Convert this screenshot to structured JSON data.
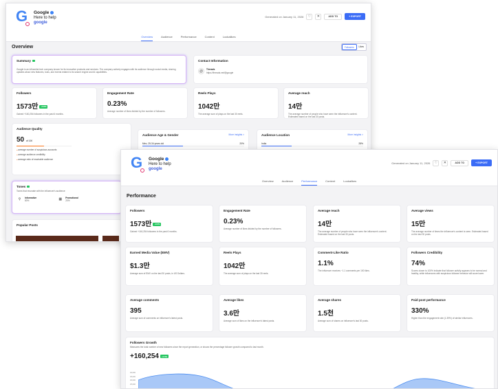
{
  "brand": {
    "name": "Google",
    "tagline": "Here to help",
    "handle": "google"
  },
  "header": {
    "generated": "Generated on January 11, 2026",
    "add_to": "ADD TO",
    "export": "+ EXPORT"
  },
  "tabs": [
    "Overview",
    "Audience",
    "Performance",
    "Content",
    "Lookalikes"
  ],
  "s1": {
    "section": "Overview",
    "toggle": [
      "Followers",
      "Likes"
    ],
    "summary_title": "Summary",
    "summary_text": "Google is an influential tech company known for its innovative products and services. The company actively engages with its audience through social media, sharing updates about new features, tools, and events related to its search engine and AI capabilities.",
    "contact_title": "Contact Information",
    "contact_site": "Threads",
    "contact_url": "https://threads.net/@google",
    "followers_t": "Followers",
    "followers_v": "1573만",
    "followers_badge": "+0.6%",
    "followers_d": "Gained +160,254 followers in the past 6 months.",
    "eng_t": "Engagement Rate",
    "eng_v": "0.23%",
    "eng_d": "Average number of likes divided by the number of followers.",
    "reels_t": "Reels Plays",
    "reels_v": "1042만",
    "reels_d": "The average sum of plays on the last 30 reels.",
    "reach_t": "Average reach",
    "reach_v": "14만",
    "reach_d": "The average number of people who have seen the influencer's content. Estimated based on the last 30 posts.",
    "aq_t": "Audience Quality",
    "aq_v": "50",
    "aq_unit": "of 100",
    "aq_b1": "average number of suspicious accounts",
    "aq_b2": "average audience credibility",
    "aq_b3": "average ratio of reachable audience",
    "age_t": "Audience Age & Gender",
    "age_more": "More insights >",
    "age_r1": "Men, 25-34 years old",
    "age_r1v": "20%",
    "age_r2": "Men, 18-24 years old",
    "age_r2v": "22%",
    "loc_t": "Audience Location",
    "loc_more": "More insights >",
    "loc_r1": "India",
    "loc_r1v": "28%",
    "loc_r2": "United States",
    "loc_r2v": "15%",
    "tones_t": "Tones",
    "tones_d": "Tones that resonate with the influencer's audience",
    "tone1": "Informative",
    "tone1v": "80%",
    "tone2": "Promotional",
    "tone2v": "20%",
    "popular": "Popular Posts"
  },
  "s2": {
    "section": "Performance",
    "c1t": "Followers",
    "c1v": "1573만",
    "c1b": "+0.6%",
    "c1d": "Gained +160,254 followers in the past 6 months.",
    "c2t": "Engagement Rate",
    "c2v": "0.23%",
    "c2d": "Average number of likes divided by the number of followers.",
    "c3t": "Average reach",
    "c3v": "14만",
    "c3d": "The average number of people who have seen the influencer's content. Estimated based on the last 30 posts.",
    "c4t": "Average views",
    "c4v": "15만",
    "c4d": "The average number of times the influencer's content is seen. Estimated based on the last 30 posts.",
    "c5t": "Earned Media Value (EMV)",
    "c5v": "$1.3만",
    "c5d": "Average sum of EMV on the last 30 posts, in US Dollars.",
    "c6t": "Reels Plays",
    "c6v": "1042만",
    "c6d": "The average sum of plays on the last 30 reels.",
    "c7t": "Comment-Like Ratio",
    "c7v": "1.1%",
    "c7d": "The influencer receives ~1.1 comments per 100 likes.",
    "c8t": "Followers Credibility",
    "c8v": "74%",
    "c8d": "Scores closer to 100% indicate that follower activity appears to be normal and healthy, while influencers with suspicious follower behavior will score lower.",
    "c9t": "Average comments",
    "c9v": "395",
    "c9d": "Average sum of comments on influencer's latest posts.",
    "c10t": "Average likes",
    "c10v": "3.6만",
    "c10d": "Average sum of likes on the influencer's latest posts.",
    "c11t": "Average shares",
    "c11v": "1.5천",
    "c11d": "Average sum of shares on influencer's last 30 posts.",
    "c12t": "Paid post performance",
    "c12v": "330%",
    "c12d": "Higher than the engagement rate (1.39%) of similar influencers.",
    "fg_t": "Followers Growth",
    "fg_d": "Measures the total number of new followers since the report generation, or shows the percentage follower growth compared to last month.",
    "fg_v": "+160,254",
    "fg_b": "+0.6%",
    "fg_ticks": [
      "40,000",
      "35,000",
      "30,000",
      "25,000"
    ]
  },
  "colors": {
    "accent": "#3b6cf6",
    "badge": "#22c55e"
  }
}
